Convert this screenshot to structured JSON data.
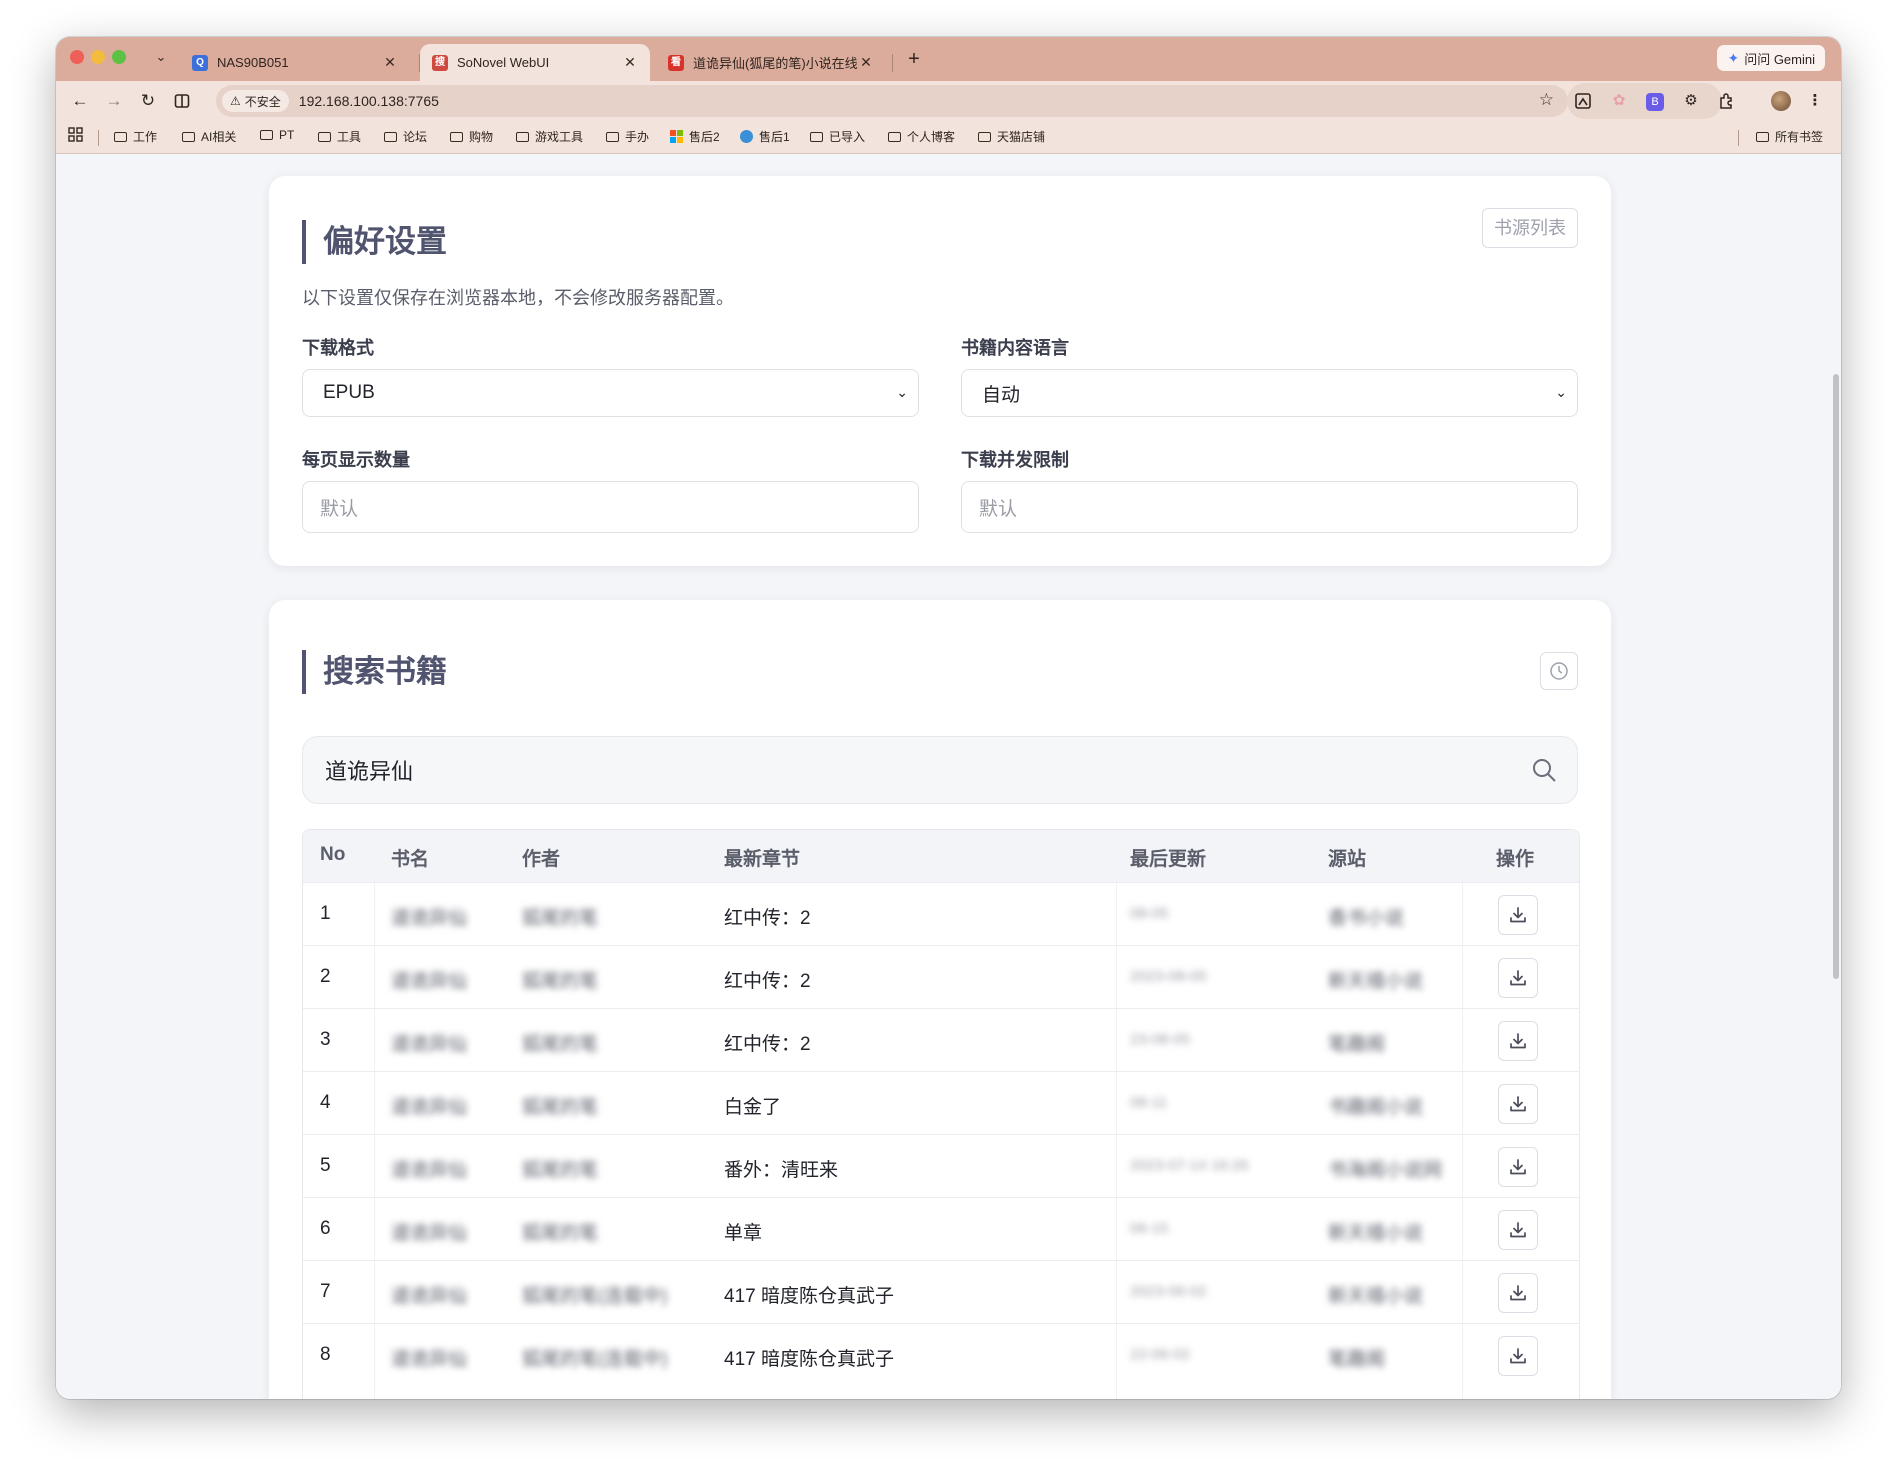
{
  "browser": {
    "tabs": [
      {
        "title": "NAS90B051",
        "favicon_color": "#3c6fd8",
        "favicon_glyph": "Q"
      },
      {
        "title": "SoNovel WebUI",
        "favicon_color": "#cf4a3f",
        "favicon_glyph": "搜"
      },
      {
        "title": "道诡异仙(狐尾的笔)小说在线阅",
        "favicon_color": "#d8332b",
        "favicon_glyph": "看"
      }
    ],
    "new_tab": "+",
    "gemini_label": "问问 Gemini",
    "security_label": "不安全",
    "url": "192.168.100.138:7765",
    "bookmarks": [
      {
        "label": "工作",
        "icon": "folder-icon"
      },
      {
        "label": "AI相关",
        "icon": "folder-icon"
      },
      {
        "label": "PT",
        "icon": "folder-icon"
      },
      {
        "label": "工具",
        "icon": "folder-icon"
      },
      {
        "label": "论坛",
        "icon": "folder-icon"
      },
      {
        "label": "购物",
        "icon": "folder-icon"
      },
      {
        "label": "游戏工具",
        "icon": "folder-icon"
      },
      {
        "label": "手办",
        "icon": "folder-icon"
      },
      {
        "label": "售后2",
        "icon": "windows-icon"
      },
      {
        "label": "售后1",
        "icon": "globe-icon"
      },
      {
        "label": "已导入",
        "icon": "folder-icon"
      },
      {
        "label": "个人博客",
        "icon": "folder-icon"
      },
      {
        "label": "天猫店铺",
        "icon": "folder-icon"
      }
    ],
    "all_bookmarks": "所有书签"
  },
  "prefs": {
    "title": "偏好设置",
    "subtitle": "以下设置仅保存在浏览器本地，不会修改服务器配置。",
    "source_list_button": "书源列表",
    "download_format_label": "下载格式",
    "download_format_value": "EPUB",
    "language_label": "书籍内容语言",
    "language_value": "自动",
    "page_size_label": "每页显示数量",
    "page_size_placeholder": "默认",
    "concurrency_label": "下载并发限制",
    "concurrency_placeholder": "默认"
  },
  "search": {
    "title": "搜索书籍",
    "query": "道诡异仙",
    "columns": [
      "No",
      "书名",
      "作者",
      "最新章节",
      "最后更新",
      "源站",
      "操作"
    ],
    "rows": [
      {
        "no": "1",
        "book": "道诡异仙",
        "author": "狐尾的笔",
        "chapter": "红中传：2",
        "updated": "08-05",
        "source": "香书小说"
      },
      {
        "no": "2",
        "book": "道诡异仙",
        "author": "狐尾的笔",
        "chapter": "红中传：2",
        "updated": "2023-08-05",
        "source": "新天禧小说"
      },
      {
        "no": "3",
        "book": "道诡异仙",
        "author": "狐尾的笔",
        "chapter": "红中传：2",
        "updated": "23-08-05",
        "source": "笔趣阁"
      },
      {
        "no": "4",
        "book": "道诡异仙",
        "author": "狐尾的笔",
        "chapter": "白金了",
        "updated": "08-11",
        "source": "书趣阁小说"
      },
      {
        "no": "5",
        "book": "道诡异仙",
        "author": "狐尾的笔",
        "chapter": "番外：清旺来",
        "updated": "2023-07-14 16:26",
        "source": "书海阁小说网"
      },
      {
        "no": "6",
        "book": "道诡异仙",
        "author": "狐尾的笔",
        "chapter": "单章",
        "updated": "06-15",
        "source": "新天禧小说"
      },
      {
        "no": "7",
        "book": "道诡异仙",
        "author": "狐尾的笔(连载中)",
        "chapter": "417 暗度陈仓真武子",
        "updated": "2023-06-02",
        "source": "新天禧小说"
      },
      {
        "no": "8",
        "book": "道诡异仙",
        "author": "狐尾的笔(连载中)",
        "chapter": "417 暗度陈仓真武子",
        "updated": "22-06-02",
        "source": "笔趣阁"
      }
    ]
  }
}
